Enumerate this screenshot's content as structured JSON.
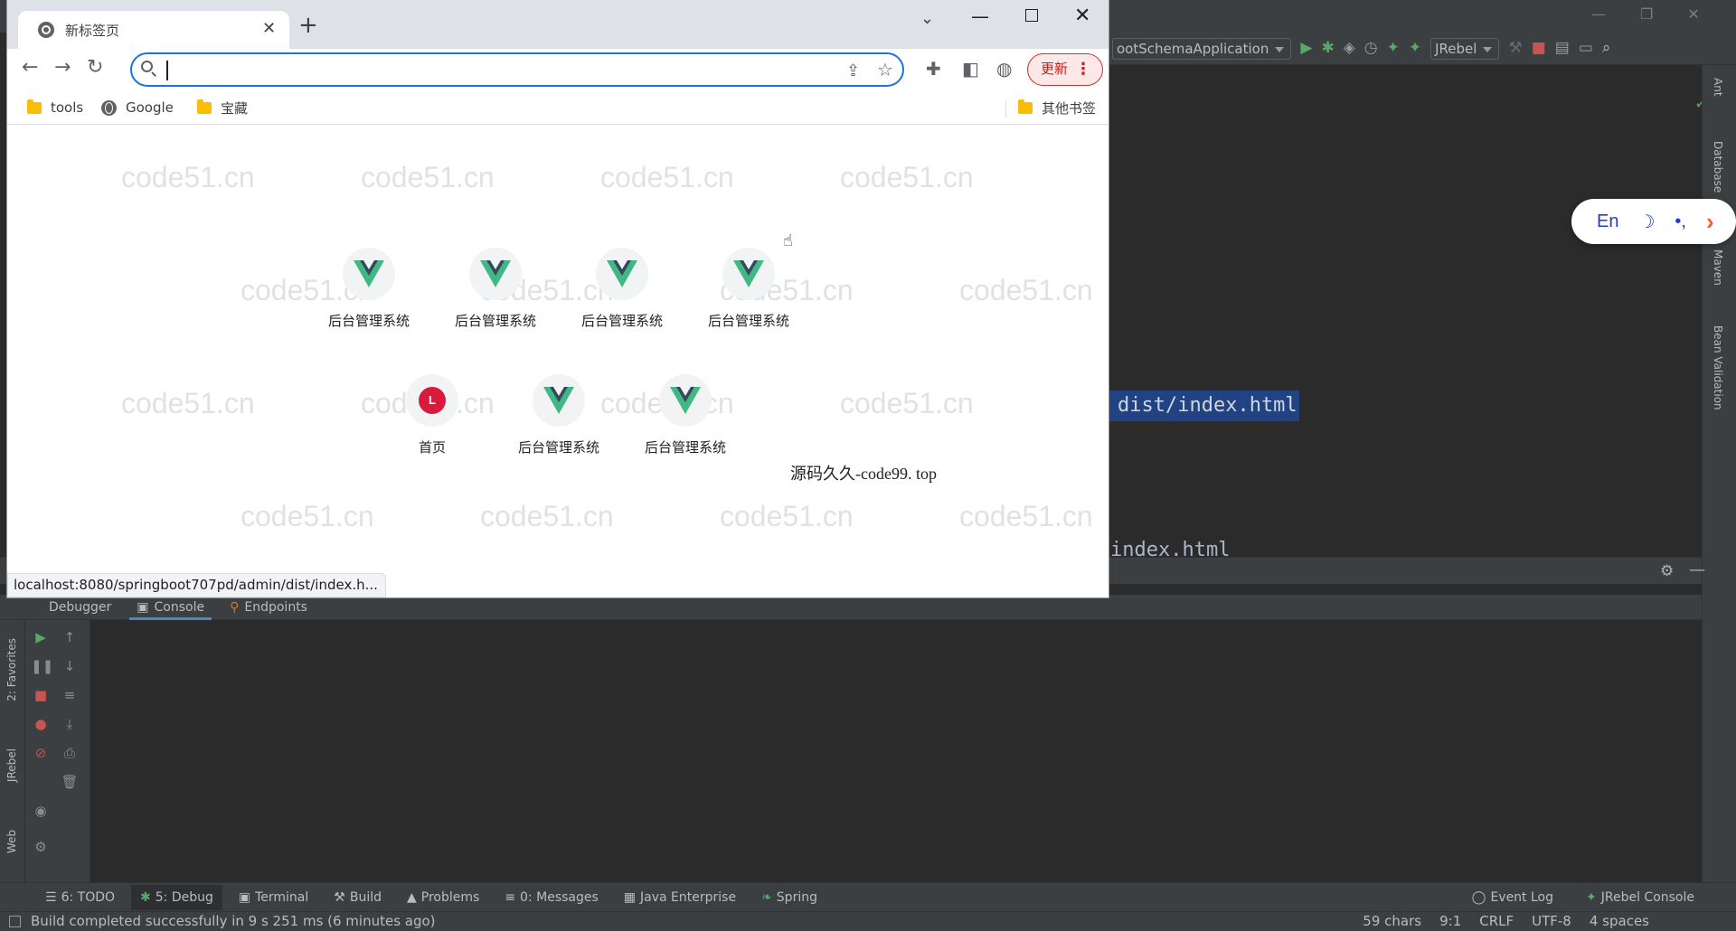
{
  "ide": {
    "run_config": "ootSchemaApplication",
    "jrebel_dropdown": "JRebel",
    "editor_line_selected": "dist/index.html",
    "editor_line_partial": "index.html",
    "right_strip": [
      "Ant",
      "Database",
      "Maven",
      "Bean Validation"
    ],
    "left_strip": [
      "2: Favorites",
      "JRebel",
      "Web"
    ],
    "panel_tabs": [
      {
        "label": "Debugger",
        "active": false
      },
      {
        "label": "Console",
        "active": true
      },
      {
        "label": "Endpoints",
        "active": false
      }
    ],
    "toolwindow_buttons": [
      {
        "label": "6: TODO",
        "active": false
      },
      {
        "label": "5: Debug",
        "active": true
      },
      {
        "label": "Terminal",
        "active": false
      },
      {
        "label": "Build",
        "active": false
      },
      {
        "label": "Problems",
        "active": false
      },
      {
        "label": "0: Messages",
        "active": false
      },
      {
        "label": "Java Enterprise",
        "active": false
      },
      {
        "label": "Spring",
        "active": false
      }
    ],
    "toolwindow_right": [
      "Event Log",
      "JRebel Console"
    ],
    "status_message": "Build completed successfully in 9 s 251 ms (6 minutes ago)",
    "status_right": [
      "59 chars",
      "9:1",
      "CRLF",
      "UTF-8",
      "4 spaces"
    ]
  },
  "ime": {
    "lang": "En",
    "moon": "☽",
    "punct": "•,"
  },
  "browser": {
    "tab_title": "新标签页",
    "omnibox_value": "",
    "update_label": "更新",
    "bookmarks": [
      "tools",
      "Google",
      "宝藏"
    ],
    "other_bookmarks": "其他书签",
    "status_url": "localhost:8080/springboot707pd/admin/dist/index.h...",
    "overlay_caption": "源码久久-code99. top",
    "watermark_text": "code51.cn",
    "shortcuts_row1": [
      "后台管理系统",
      "后台管理系统",
      "后台管理系统",
      "后台管理系统"
    ],
    "shortcuts_row2": [
      {
        "label": "首页",
        "icon": "L"
      },
      {
        "label": "后台管理系统",
        "icon": "vue"
      },
      {
        "label": "后台管理系统",
        "icon": "vue"
      }
    ]
  },
  "colors": {
    "vue_green": "#41b883",
    "vue_dark": "#35495e",
    "ide_bg": "#2b2b2b",
    "ide_panel": "#3c3f41",
    "omnibox_focus": "#1a73e8",
    "update_red": "#d93025",
    "selection_blue": "#214283"
  }
}
